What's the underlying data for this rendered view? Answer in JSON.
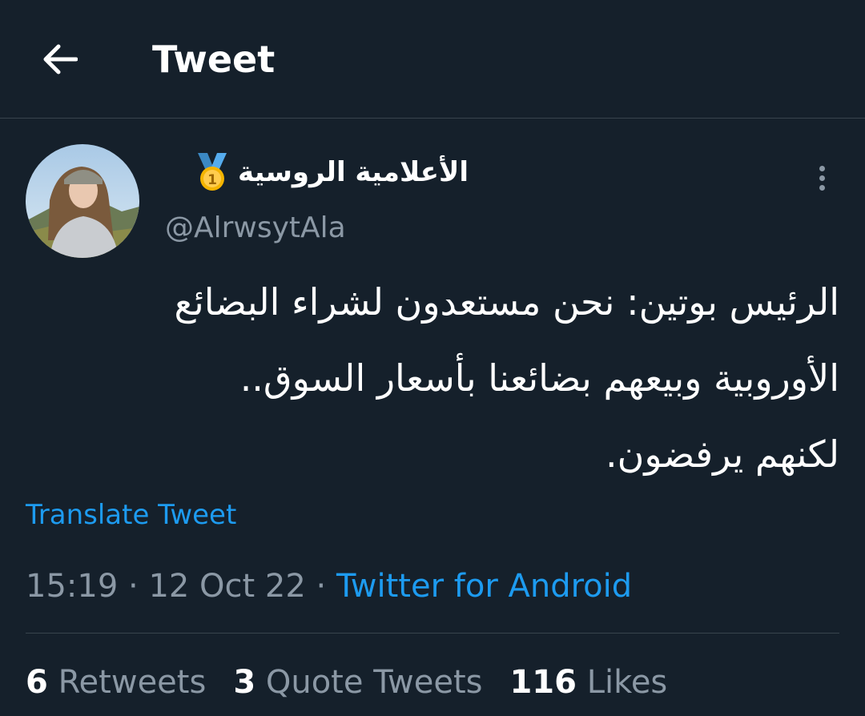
{
  "header": {
    "title": "Tweet",
    "back_icon": "arrow-left-icon"
  },
  "tweet": {
    "author": {
      "display_name": "الأعلامية الروسية",
      "badge_icon": "first-place-medal-icon",
      "handle": "@AlrwsytAla"
    },
    "more_icon": "more-vertical-icon",
    "text": "الرئيس بوتين: نحن مستعدون لشراء البضائع\nالأوروبية وبيعهم بضائعنا بأسعار السوق..\nلكنهم يرفضون.",
    "translate_label": "Translate Tweet",
    "time": "15:19",
    "date": "12 Oct 22",
    "source": "Twitter for Android",
    "stats": {
      "retweets_count": "6",
      "retweets_label": "Retweets",
      "quotes_count": "3",
      "quotes_label": "Quote Tweets",
      "likes_count": "116",
      "likes_label": "Likes"
    }
  },
  "colors": {
    "background": "#15202b",
    "accent": "#1d9bf0",
    "secondary_text": "#8b98a5",
    "divider": "#38444d"
  }
}
